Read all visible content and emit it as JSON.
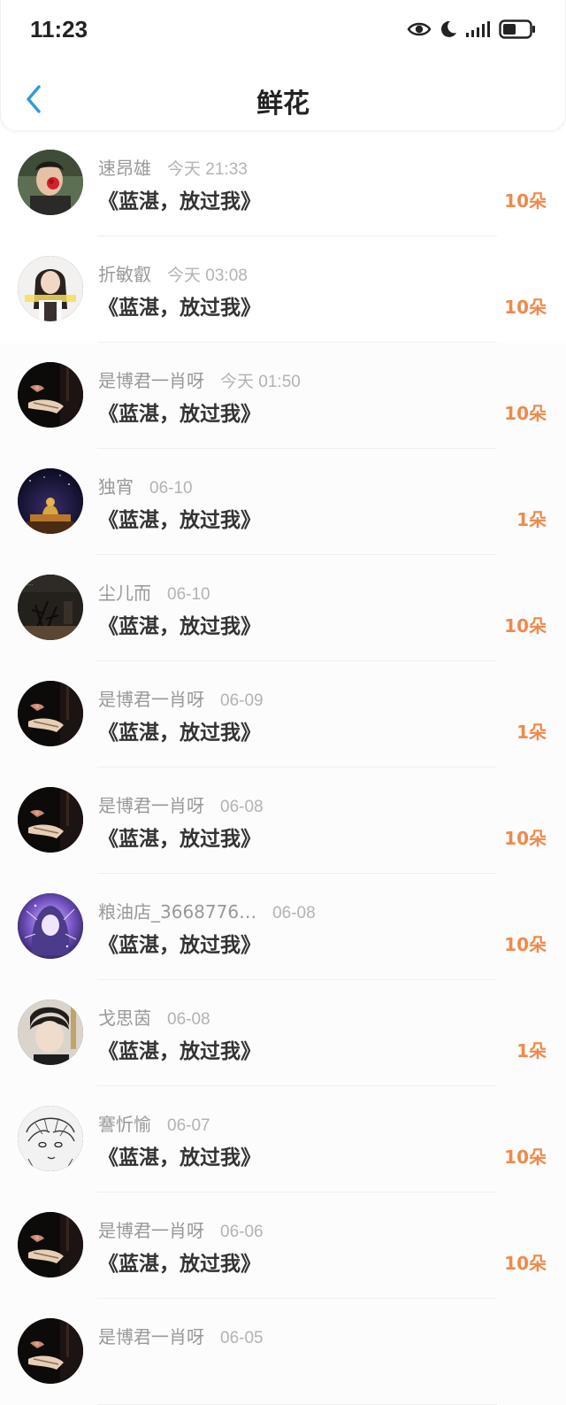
{
  "status_bar": {
    "time": "11:23",
    "icons": [
      "eye-icon",
      "moon-icon",
      "signal-icon",
      "battery-icon"
    ]
  },
  "nav": {
    "back_icon": "chevron-left-icon",
    "title": "鲜花"
  },
  "colors": {
    "accent_blue": "#2f9bd9",
    "count_orange": "#f0894a",
    "name_gray": "#999999"
  },
  "records": [
    {
      "name": "速昂雄",
      "time": "今天 21:33",
      "title": "《蓝湛，放过我》",
      "count": "10朵",
      "avatar": "rose-portrait"
    },
    {
      "name": "折敏叡",
      "time": "今天 03:08",
      "title": "《蓝湛，放过我》",
      "count": "10朵",
      "avatar": "girl-portrait"
    },
    {
      "name": "是博君一肖呀",
      "time": "今天 01:50",
      "title": "《蓝湛，放过我》",
      "count": "10朵",
      "avatar": "dark-hands"
    },
    {
      "name": "独宵",
      "time": "06-10",
      "title": "《蓝湛，放过我》",
      "count": "1朵",
      "avatar": "night-temple"
    },
    {
      "name": "尘儿而",
      "time": "06-10",
      "title": "《蓝湛，放过我》",
      "count": "10朵",
      "avatar": "dark-plant"
    },
    {
      "name": "是博君一肖呀",
      "time": "06-09",
      "title": "《蓝湛，放过我》",
      "count": "1朵",
      "avatar": "dark-hands"
    },
    {
      "name": "是博君一肖呀",
      "time": "06-08",
      "title": "《蓝湛，放过我》",
      "count": "10朵",
      "avatar": "dark-hands"
    },
    {
      "name": "粮油店_3668776…",
      "time": "06-08",
      "title": "《蓝湛，放过我》",
      "count": "10朵",
      "avatar": "purple-fantasy"
    },
    {
      "name": "戈思茵",
      "time": "06-08",
      "title": "《蓝湛，放过我》",
      "count": "1朵",
      "avatar": "boy-portrait"
    },
    {
      "name": "謇忻愉",
      "time": "06-07",
      "title": "《蓝湛，放过我》",
      "count": "10朵",
      "avatar": "sketch-face"
    },
    {
      "name": "是博君一肖呀",
      "time": "06-06",
      "title": "《蓝湛，放过我》",
      "count": "10朵",
      "avatar": "dark-hands"
    },
    {
      "name": "是博君一肖呀",
      "time": "06-05",
      "title": "",
      "count": "",
      "avatar": "dark-hands"
    }
  ]
}
